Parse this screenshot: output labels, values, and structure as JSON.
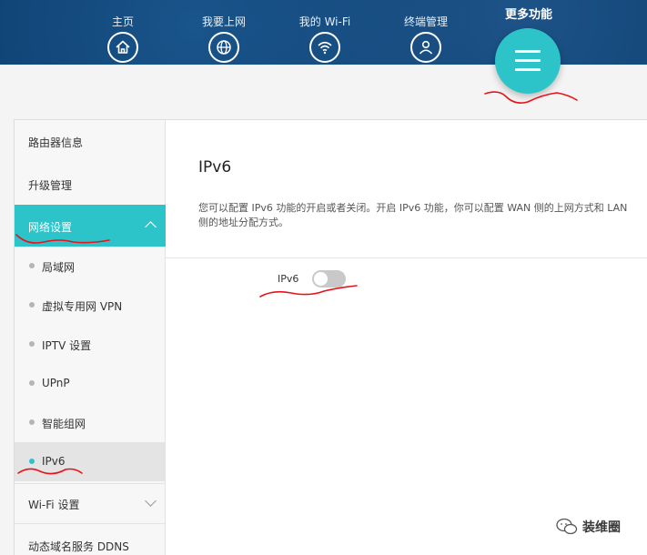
{
  "nav": {
    "items": [
      {
        "label": "主页",
        "icon": "home-icon"
      },
      {
        "label": "我要上网",
        "icon": "globe-icon"
      },
      {
        "label": "我的 Wi-Fi",
        "icon": "wifi-icon"
      },
      {
        "label": "终端管理",
        "icon": "user-icon"
      }
    ],
    "more": {
      "label": "更多功能",
      "icon": "menu-icon"
    }
  },
  "sidebar": {
    "items": [
      {
        "label": "路由器信息"
      },
      {
        "label": "升级管理"
      },
      {
        "label": "网络设置",
        "expanded": true
      },
      {
        "label": "Wi-Fi 设置",
        "expanded": false
      },
      {
        "label": "动态域名服务 DDNS"
      }
    ],
    "sub_items": [
      {
        "label": "局域网"
      },
      {
        "label": "虚拟专用网 VPN"
      },
      {
        "label": "IPTV 设置"
      },
      {
        "label": "UPnP"
      },
      {
        "label": "智能组网"
      },
      {
        "label": "IPv6",
        "selected": true
      }
    ]
  },
  "main": {
    "title": "IPv6",
    "description": "您可以配置 IPv6 功能的开启或者关闭。开启 IPv6 功能，你可以配置 WAN 侧的上网方式和 LAN 侧的地址分配方式。",
    "toggle": {
      "label": "IPv6",
      "state": "off"
    }
  },
  "watermark": {
    "text": "装维圈"
  },
  "colors": {
    "topbar": "#0d3f70",
    "accent": "#2cc3c9",
    "annotation": "#e8121a"
  }
}
